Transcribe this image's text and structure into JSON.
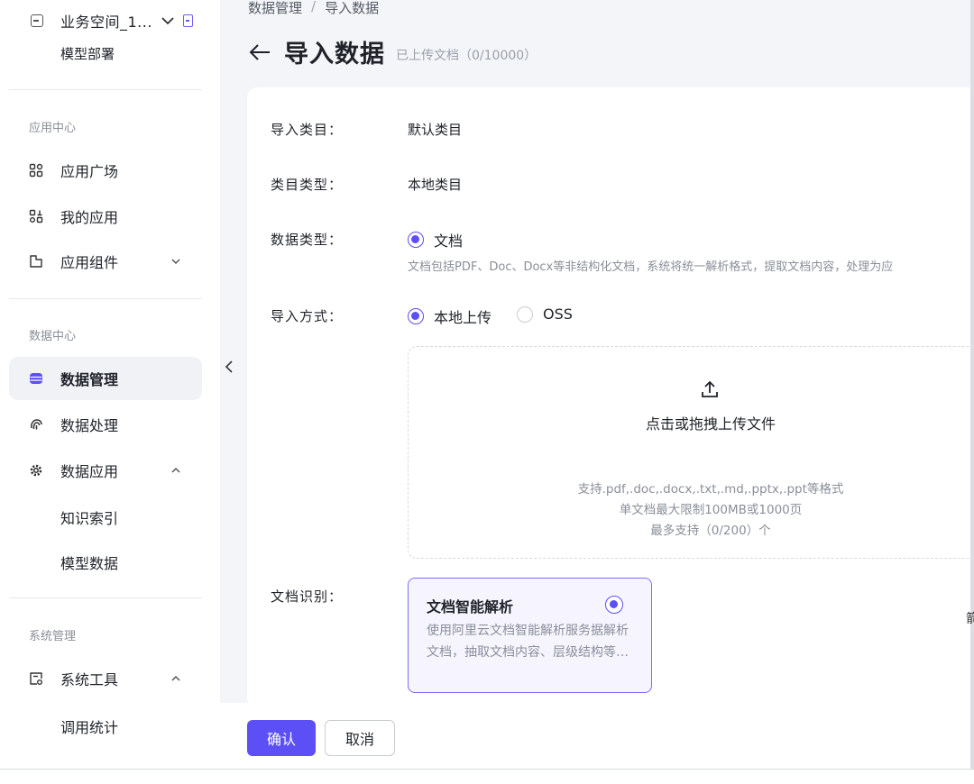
{
  "sidebar": {
    "workspace": {
      "name": "业务空间_1...",
      "sub_item": "模型部署"
    },
    "groups": [
      {
        "title": "应用中心",
        "items": [
          "应用广场",
          "我的应用",
          "应用组件"
        ]
      },
      {
        "title": "数据中心",
        "items": [
          "数据管理",
          "数据处理",
          "数据应用"
        ],
        "sub_items": [
          "知识索引",
          "模型数据"
        ]
      },
      {
        "title": "系统管理",
        "items": [
          "系统工具"
        ],
        "sub_items": [
          "调用统计"
        ]
      }
    ],
    "active_item": "数据管理",
    "icons": {
      "workspace": "workspace-icon",
      "app_square": "grid-icon",
      "my_apps": "user-apps-icon",
      "app_components": "component-icon",
      "data_manage": "database-icon",
      "data_process": "fingerprint-icon",
      "data_app": "gear-icon",
      "system_tools": "toolbox-icon"
    }
  },
  "header": {
    "breadcrumb": [
      "数据管理",
      "/",
      "导入数据"
    ],
    "title": "导入数据",
    "upload_count": "已上传文档（0/10000）"
  },
  "form": {
    "import_category_label": "导入类目：",
    "import_category_value": "默认类目",
    "category_type_label": "类目类型：",
    "category_type_value": "本地类目",
    "data_type_label": "数据类型：",
    "data_type_option": "文档",
    "data_type_hint": "文档包括PDF、Doc、Docx等非结构化文档，系统将统一解析格式，提取文档内容，处理为应",
    "import_method_label": "导入方式：",
    "import_method_options": [
      "本地上传",
      "OSS"
    ],
    "import_method_selected": "本地上传",
    "upload": {
      "title": "点击或拖拽上传文件",
      "formats": "支持.pdf,.doc,.docx,.txt,.md,.pptx,.ppt等格式",
      "size_limit": "单文档最大限制100MB或1000页",
      "count_limit": "最多支持（0/200）个"
    },
    "doc_recognition_label": "文档识别：",
    "parse_option": {
      "title": "文档智能解析",
      "description": "使用阿里云文档智能解析服务据解析文档，抽取文档内容、层级结构等信息"
    }
  },
  "footer": {
    "confirm": "确认",
    "cancel": "取消"
  },
  "edge_glyph": "箭",
  "colors": {
    "accent": "#5b4ff5",
    "sidebar_active": "#f1f2f5",
    "main_bg": "#f4f5f8"
  }
}
